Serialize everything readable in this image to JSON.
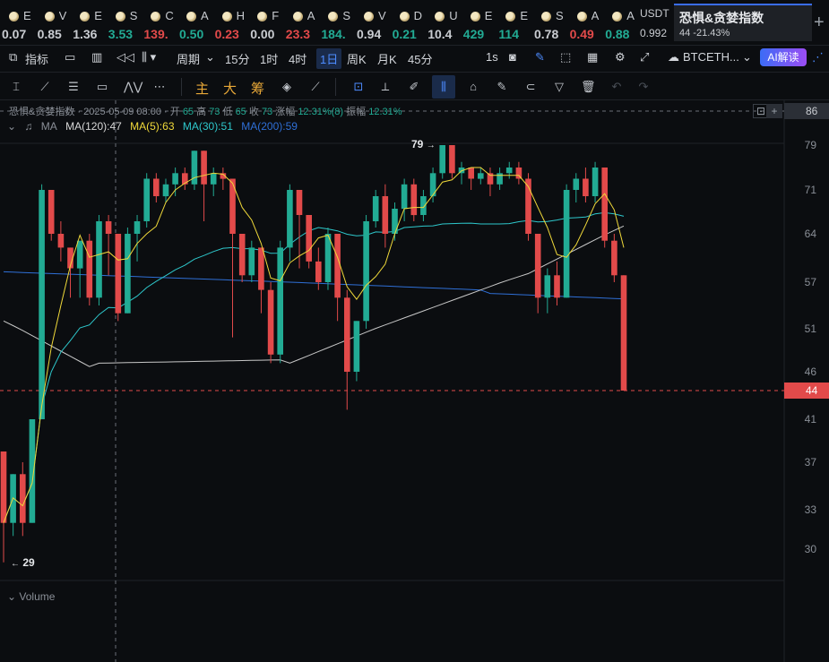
{
  "tickers": [
    {
      "sym": "E",
      "val": "0.07",
      "color": "#c9ccd1"
    },
    {
      "sym": "V",
      "val": "0.85",
      "color": "#c9ccd1"
    },
    {
      "sym": "E",
      "val": "1.36",
      "color": "#c9ccd1"
    },
    {
      "sym": "S",
      "val": "3.53",
      "color": "#22ab94"
    },
    {
      "sym": "C",
      "val": "139.",
      "color": "#e24a4a"
    },
    {
      "sym": "A",
      "val": "0.50",
      "color": "#22ab94"
    },
    {
      "sym": "H",
      "val": "0.23",
      "color": "#e24a4a"
    },
    {
      "sym": "F",
      "val": "0.00",
      "color": "#c9ccd1"
    },
    {
      "sym": "A",
      "val": "23.3",
      "color": "#e24a4a"
    },
    {
      "sym": "S",
      "val": "184.",
      "color": "#22ab94"
    },
    {
      "sym": "V",
      "val": "0.94",
      "color": "#c9ccd1"
    },
    {
      "sym": "D",
      "val": "0.21",
      "color": "#22ab94"
    },
    {
      "sym": "U",
      "val": "10.4",
      "color": "#c9ccd1"
    },
    {
      "sym": "E",
      "val": "429",
      "color": "#22ab94"
    },
    {
      "sym": "E",
      "val": "114",
      "color": "#22ab94"
    },
    {
      "sym": "S",
      "val": "0.78",
      "color": "#c9ccd1"
    },
    {
      "sym": "A",
      "val": "0.49",
      "color": "#e24a4a"
    },
    {
      "sym": "A",
      "val": "0.88",
      "color": "#22ab94"
    }
  ],
  "usd": {
    "label": "USDT",
    "value": "0.992"
  },
  "active_tab": {
    "title": "恐惧&贪婪指数",
    "sub": "44  -21.43%"
  },
  "toolbar": {
    "indicator": "指标",
    "period": "周期",
    "intervals": [
      "15分",
      "1时",
      "4时",
      "1日",
      "周K",
      "月K",
      "45分"
    ],
    "selected_interval": "1日",
    "sec": "1s",
    "symbol": "BTCETH...",
    "ai": "AI解读"
  },
  "drawing": {
    "c1": "主",
    "c2": "大",
    "c3": "筹"
  },
  "legend": {
    "line1": "恐惧&贪婪指数 · 2025-05-09 08:00 · 开",
    "open": "65",
    "high_lbl": "高",
    "high": "73",
    "low_lbl": "低",
    "low": "65",
    "close_lbl": "收",
    "close": "73",
    "chg_lbl": "涨幅",
    "chg": "12.31%(8)",
    "amp_lbl": "振幅",
    "amp": "12.31%",
    "ma_title": "MA",
    "ma120": "MA(120):47",
    "ma5": "MA(5):63",
    "ma30": "MA(30):51",
    "ma200": "MA(200):59"
  },
  "colors": {
    "up": "#22ab94",
    "down": "#e24a4a",
    "ma5": "#f0d93a",
    "ma30": "#2ec8cc",
    "ma120": "#c8c8c8",
    "ma200": "#2f6fd6"
  },
  "axis": {
    "ticks": [
      "86",
      "79",
      "71",
      "64",
      "57",
      "51",
      "46",
      "41",
      "37",
      "33",
      "30"
    ],
    "current": "44",
    "top": "86"
  },
  "marks": {
    "high": "79",
    "low": "29"
  },
  "volume": "Volume",
  "chart_data": {
    "type": "candlestick",
    "title": "恐惧&贪婪指数",
    "series": [
      {
        "o": 38,
        "c": 32,
        "h": 38,
        "l": 29
      },
      {
        "o": 32,
        "c": 36,
        "h": 36,
        "l": 31
      },
      {
        "o": 36,
        "c": 32,
        "h": 37,
        "l": 31
      },
      {
        "o": 32,
        "c": 41,
        "h": 41,
        "l": 32
      },
      {
        "o": 41,
        "c": 71,
        "h": 72,
        "l": 41
      },
      {
        "o": 71,
        "c": 64,
        "h": 71,
        "l": 63
      },
      {
        "o": 64,
        "c": 62,
        "h": 66,
        "l": 60
      },
      {
        "o": 62,
        "c": 59,
        "h": 62,
        "l": 55
      },
      {
        "o": 59,
        "c": 63,
        "h": 63,
        "l": 55
      },
      {
        "o": 63,
        "c": 55,
        "h": 64,
        "l": 54
      },
      {
        "o": 55,
        "c": 66,
        "h": 67,
        "l": 54
      },
      {
        "o": 66,
        "c": 64,
        "h": 67,
        "l": 58
      },
      {
        "o": 64,
        "c": 53,
        "h": 64,
        "l": 52
      },
      {
        "o": 53,
        "c": 64,
        "h": 65,
        "l": 53
      },
      {
        "o": 64,
        "c": 66,
        "h": 67,
        "l": 60
      },
      {
        "o": 66,
        "c": 73,
        "h": 74,
        "l": 65
      },
      {
        "o": 73,
        "c": 70,
        "h": 74,
        "l": 69
      },
      {
        "o": 70,
        "c": 72,
        "h": 73,
        "l": 69
      },
      {
        "o": 72,
        "c": 74,
        "h": 75,
        "l": 70
      },
      {
        "o": 74,
        "c": 72,
        "h": 75,
        "l": 71
      },
      {
        "o": 72,
        "c": 78,
        "h": 78,
        "l": 71
      },
      {
        "o": 78,
        "c": 72,
        "h": 78,
        "l": 66
      },
      {
        "o": 72,
        "c": 74,
        "h": 75,
        "l": 70
      },
      {
        "o": 74,
        "c": 73,
        "h": 75,
        "l": 71
      },
      {
        "o": 73,
        "c": 64,
        "h": 73,
        "l": 50
      },
      {
        "o": 64,
        "c": 58,
        "h": 64,
        "l": 57
      },
      {
        "o": 58,
        "c": 62,
        "h": 63,
        "l": 57
      },
      {
        "o": 62,
        "c": 56,
        "h": 62,
        "l": 53
      },
      {
        "o": 56,
        "c": 48,
        "h": 57,
        "l": 47
      },
      {
        "o": 48,
        "c": 62,
        "h": 63,
        "l": 47
      },
      {
        "o": 62,
        "c": 71,
        "h": 72,
        "l": 60
      },
      {
        "o": 71,
        "c": 67,
        "h": 71,
        "l": 59
      },
      {
        "o": 67,
        "c": 60,
        "h": 67,
        "l": 59
      },
      {
        "o": 60,
        "c": 57,
        "h": 62,
        "l": 56
      },
      {
        "o": 57,
        "c": 64,
        "h": 65,
        "l": 56
      },
      {
        "o": 64,
        "c": 55,
        "h": 64,
        "l": 52
      },
      {
        "o": 55,
        "c": 46,
        "h": 56,
        "l": 42
      },
      {
        "o": 46,
        "c": 52,
        "h": 52,
        "l": 45
      },
      {
        "o": 52,
        "c": 66,
        "h": 67,
        "l": 51
      },
      {
        "o": 66,
        "c": 70,
        "h": 71,
        "l": 65
      },
      {
        "o": 70,
        "c": 64,
        "h": 72,
        "l": 62
      },
      {
        "o": 64,
        "c": 68,
        "h": 69,
        "l": 63
      },
      {
        "o": 68,
        "c": 72,
        "h": 73,
        "l": 66
      },
      {
        "o": 72,
        "c": 67,
        "h": 73,
        "l": 66
      },
      {
        "o": 67,
        "c": 70,
        "h": 71,
        "l": 66
      },
      {
        "o": 70,
        "c": 74,
        "h": 75,
        "l": 69
      },
      {
        "o": 74,
        "c": 79,
        "h": 79,
        "l": 73
      },
      {
        "o": 79,
        "c": 74,
        "h": 79,
        "l": 73
      },
      {
        "o": 74,
        "c": 75,
        "h": 76,
        "l": 72
      },
      {
        "o": 75,
        "c": 73,
        "h": 75,
        "l": 71
      },
      {
        "o": 73,
        "c": 74,
        "h": 75,
        "l": 72
      },
      {
        "o": 74,
        "c": 72,
        "h": 75,
        "l": 70
      },
      {
        "o": 72,
        "c": 74,
        "h": 75,
        "l": 71
      },
      {
        "o": 74,
        "c": 75,
        "h": 76,
        "l": 73
      },
      {
        "o": 75,
        "c": 73,
        "h": 76,
        "l": 72
      },
      {
        "o": 73,
        "c": 64,
        "h": 74,
        "l": 63
      },
      {
        "o": 64,
        "c": 55,
        "h": 64,
        "l": 53
      },
      {
        "o": 55,
        "c": 58,
        "h": 59,
        "l": 53
      },
      {
        "o": 58,
        "c": 55,
        "h": 60,
        "l": 54
      },
      {
        "o": 55,
        "c": 71,
        "h": 72,
        "l": 55
      },
      {
        "o": 71,
        "c": 73,
        "h": 74,
        "l": 69
      },
      {
        "o": 73,
        "c": 70,
        "h": 75,
        "l": 69
      },
      {
        "o": 70,
        "c": 75,
        "h": 76,
        "l": 69
      },
      {
        "o": 75,
        "c": 63,
        "h": 75,
        "l": 62
      },
      {
        "o": 63,
        "c": 58,
        "h": 64,
        "l": 57
      },
      {
        "o": 58,
        "c": 44,
        "h": 58,
        "l": 44
      }
    ],
    "ylim": [
      27,
      88
    ],
    "current": 44
  }
}
